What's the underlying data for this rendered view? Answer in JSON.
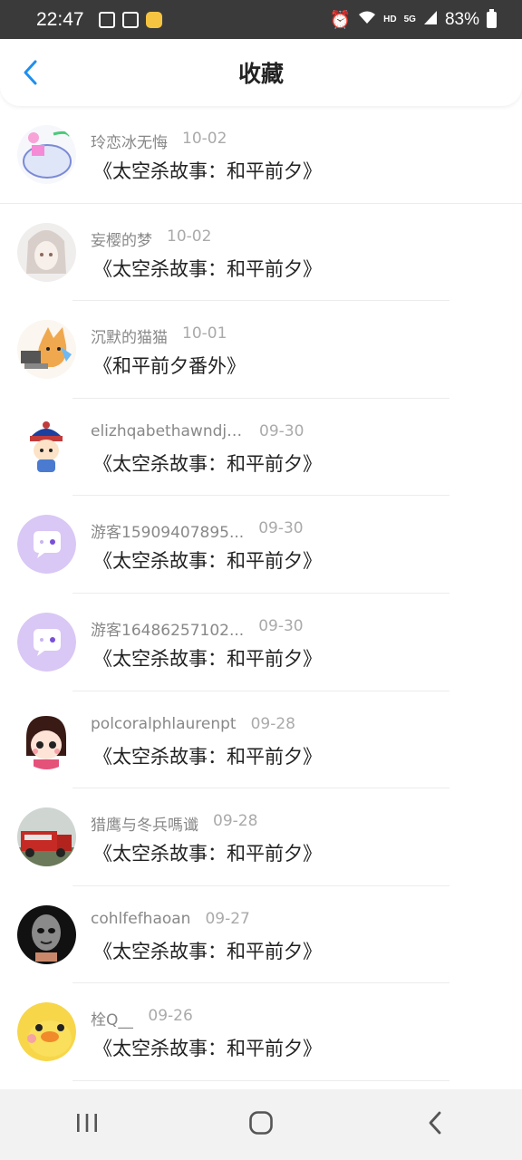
{
  "status_bar": {
    "time": "22:47",
    "battery": "83%",
    "net_small": "HD",
    "net_gen": "5G"
  },
  "header": {
    "title": "收藏",
    "back_icon": "chevron-left-icon"
  },
  "colors": {
    "accent": "#1e8ff0",
    "status_bar_bg": "#3a3a3a",
    "title_text": "#222222",
    "meta_text": "#888888",
    "guest_avatar": "#d9c7f5"
  },
  "favorites": [
    {
      "user": "玲恋冰无悔",
      "date": "10-02",
      "title": "《太空杀故事：和平前夕》"
    },
    {
      "user": "妄樱的梦",
      "date": "10-02",
      "title": "《太空杀故事：和平前夕》"
    },
    {
      "user": "沉默的猫猫",
      "date": "10-01",
      "title": "《和平前夕番外》"
    },
    {
      "user": "elizhqabethawndja...",
      "date": "09-30",
      "title": "《太空杀故事：和平前夕》"
    },
    {
      "user": "游客15909407895...",
      "date": "09-30",
      "title": "《太空杀故事：和平前夕》"
    },
    {
      "user": "游客16486257102...",
      "date": "09-30",
      "title": "《太空杀故事：和平前夕》"
    },
    {
      "user": "polcoralphlaurenpt",
      "date": "09-28",
      "title": "《太空杀故事：和平前夕》"
    },
    {
      "user": "猎鹰与冬兵嗎谶",
      "date": "09-28",
      "title": "《太空杀故事：和平前夕》"
    },
    {
      "user": "cohlfefhaoan",
      "date": "09-27",
      "title": "《太空杀故事：和平前夕》"
    },
    {
      "user": "栓Q__",
      "date": "09-26",
      "title": "《太空杀故事：和平前夕》"
    }
  ],
  "nav_bar": {
    "recents_icon": "recents-icon",
    "home_icon": "home-icon",
    "back_icon": "back-icon"
  }
}
